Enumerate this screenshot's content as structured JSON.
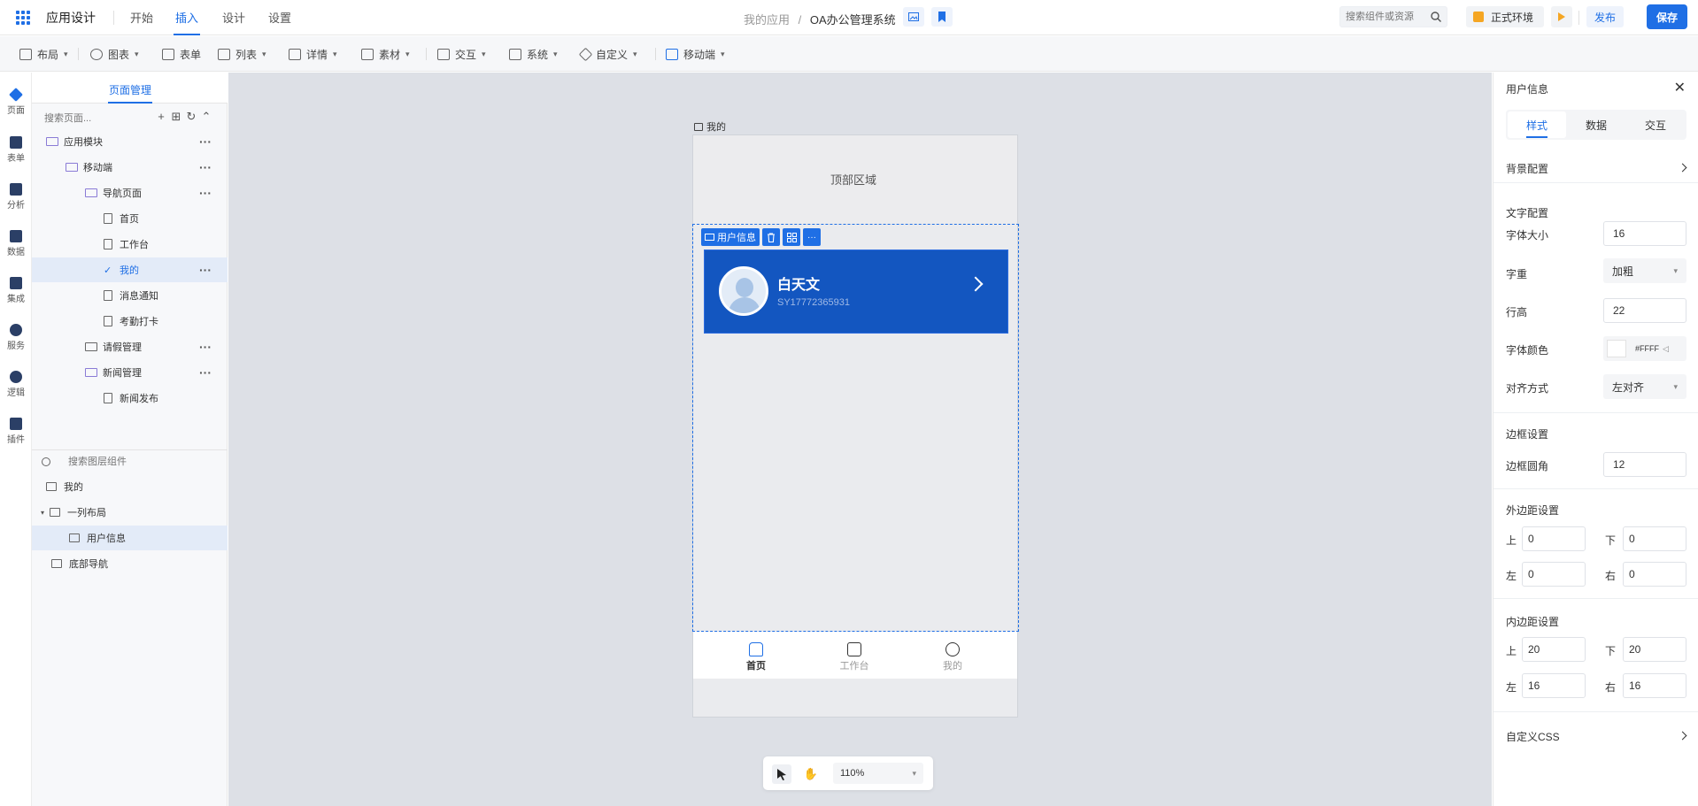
{
  "header": {
    "app_title": "应用设计",
    "tabs": [
      "开始",
      "插入",
      "设计",
      "设置"
    ],
    "breadcrumb_parent": "我的应用",
    "breadcrumb_sep": "/",
    "breadcrumb_current": "OA办公管理系统",
    "search_placeholder": "搜索组件或资源",
    "env_label": "正式环境",
    "publish_label": "发布",
    "save_label": "保存"
  },
  "toolbar": {
    "items": [
      "布局",
      "图表",
      "表单",
      "列表",
      "详情",
      "素材",
      "交互",
      "系统",
      "自定义",
      "移动端"
    ]
  },
  "rail": {
    "items": [
      "页面",
      "表单",
      "分析",
      "数据",
      "集成",
      "服务",
      "逻辑",
      "插件"
    ]
  },
  "pages_panel": {
    "title": "页面管理",
    "search_placeholder": "搜索页面...",
    "tree": [
      {
        "label": "应用模块"
      },
      {
        "label": "移动端"
      },
      {
        "label": "导航页面"
      },
      {
        "label": "首页"
      },
      {
        "label": "工作台"
      },
      {
        "label": "我的"
      },
      {
        "label": "消息通知"
      },
      {
        "label": "考勤打卡"
      },
      {
        "label": "请假管理"
      },
      {
        "label": "新闻管理"
      },
      {
        "label": "新闻发布"
      }
    ]
  },
  "layers": {
    "search_placeholder": "搜索图层组件",
    "items": [
      "我的",
      "一列布局",
      "用户信息",
      "底部导航"
    ]
  },
  "canvas": {
    "frame_label": "我的",
    "top_area_label": "顶部区域",
    "component_tag": "用户信息",
    "user_name": "白天文",
    "user_id": "SY17772365931",
    "bottom_nav": [
      "首页",
      "工作台",
      "我的"
    ],
    "zoom": "110%"
  },
  "props": {
    "title": "用户信息",
    "tabs": [
      "样式",
      "数据",
      "交互"
    ],
    "bg_config": "背景配置",
    "text_config": "文字配置",
    "font_size_label": "字体大小",
    "font_size": "16",
    "font_weight_label": "字重",
    "font_weight": "加粗",
    "line_height_label": "行高",
    "line_height": "22",
    "font_color_label": "字体颜色",
    "font_color": "#FFFF",
    "align_label": "对齐方式",
    "align": "左对齐",
    "border_section": "边框设置",
    "radius_label": "边框圆角",
    "radius": "12",
    "margin_section": "外边距设置",
    "padding_section": "内边距设置",
    "side_top": "上",
    "side_bottom": "下",
    "side_left": "左",
    "side_right": "右",
    "margin": {
      "top": "0",
      "bottom": "0",
      "left": "0",
      "right": "0"
    },
    "padding": {
      "top": "20",
      "bottom": "20",
      "left": "16",
      "right": "16"
    },
    "custom_css": "自定义CSS"
  },
  "colors": {
    "accent": "#1f6fe5",
    "card_bg": "#1356c0",
    "env_badge": "#f5a623"
  }
}
